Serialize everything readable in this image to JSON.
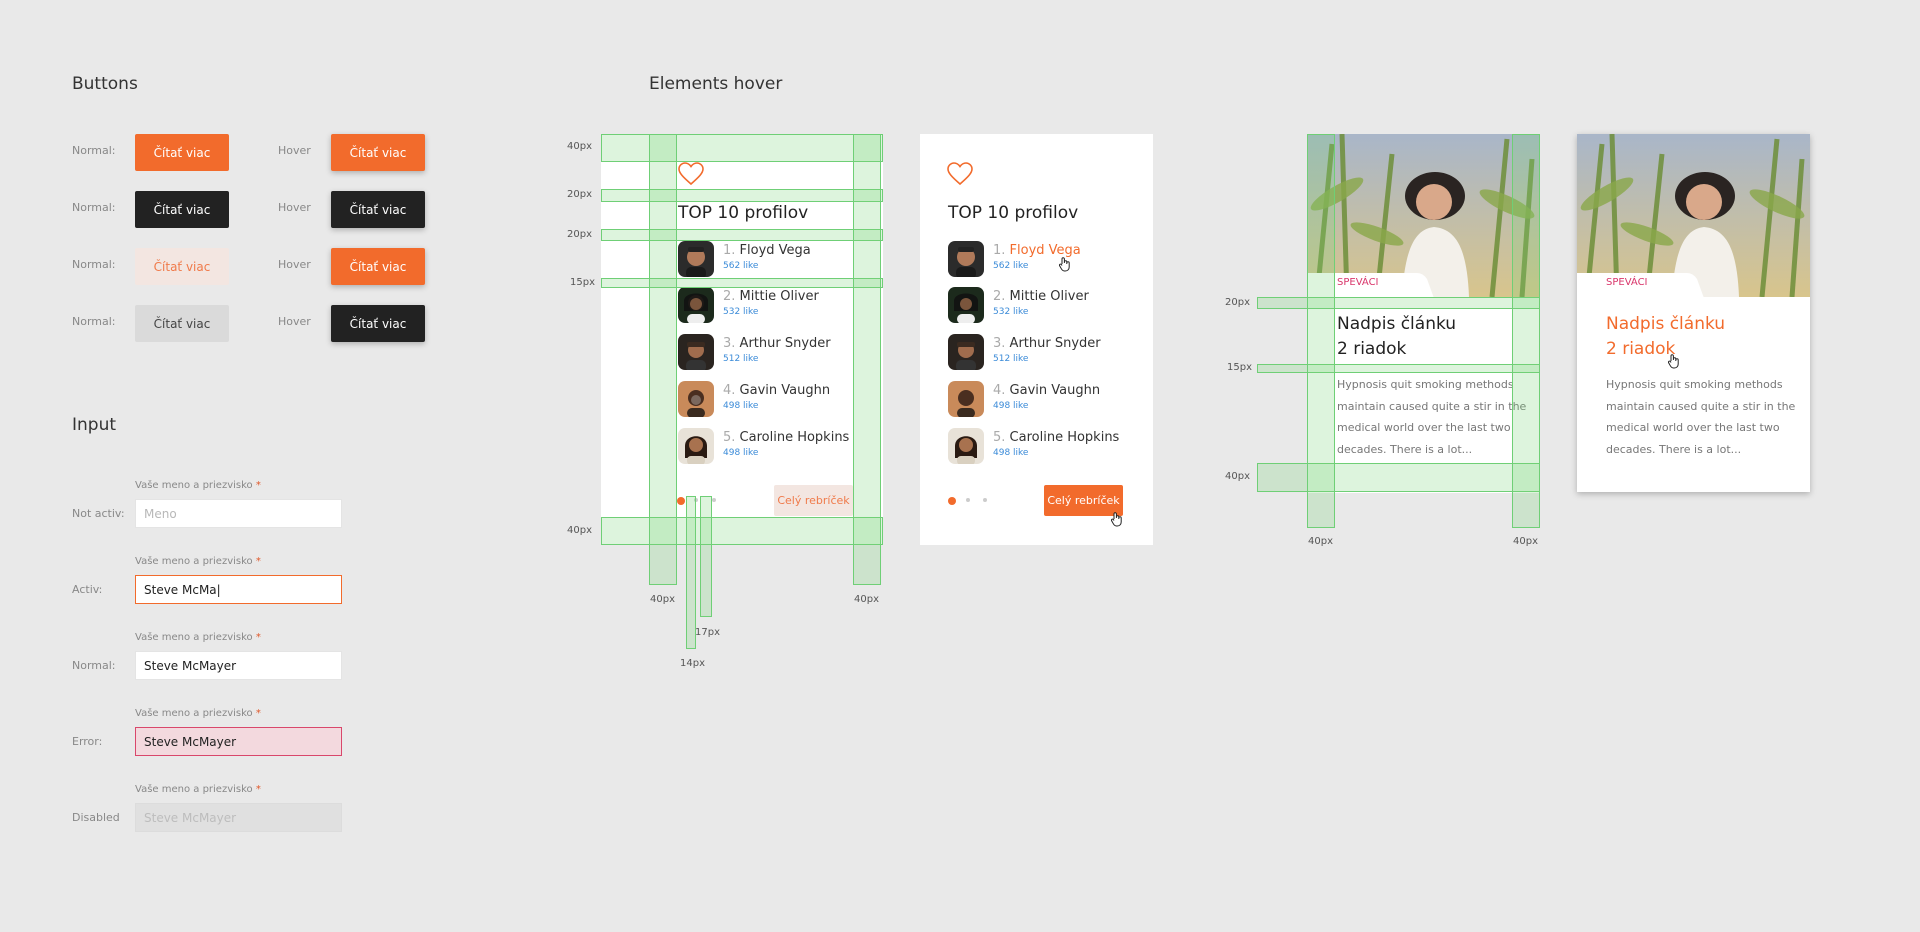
{
  "buttons_section": {
    "title": "Buttons",
    "normal_label": "Normal:",
    "hover_label": "Hover",
    "button_label": "Čítať viac"
  },
  "input_section": {
    "title": "Input",
    "field_label": "Vaše meno a priezvisko",
    "required_mark": "*",
    "rows": [
      {
        "state": "Not activ:",
        "value": "Meno"
      },
      {
        "state": "Activ:",
        "value": "Steve McMa|"
      },
      {
        "state": "Normal:",
        "value": "Steve McMayer"
      },
      {
        "state": "Error:",
        "value": "Steve McMayer"
      },
      {
        "state": "Disabled",
        "value": "Steve McMayer"
      }
    ]
  },
  "hover_section": {
    "title": "Elements hover"
  },
  "dimensions": {
    "d40": "40px",
    "d20": "20px",
    "d15": "15px",
    "d17": "17px",
    "d14": "14px"
  },
  "profiles_card": {
    "title": "TOP 10 profilov",
    "button_label": "Celý rebríček",
    "people": [
      {
        "num": "1.",
        "name": "Floyd Vega",
        "likes": "562 like"
      },
      {
        "num": "2.",
        "name": "Mittie Oliver",
        "likes": "532 like"
      },
      {
        "num": "3.",
        "name": "Arthur Snyder",
        "likes": "512 like"
      },
      {
        "num": "4.",
        "name": "Gavin Vaughn",
        "likes": "498 like"
      },
      {
        "num": "5.",
        "name": "Caroline Hopkins",
        "likes": "498 like"
      }
    ]
  },
  "article_card": {
    "tag": "SPEVÁCI",
    "title_line1": "Nadpis článku",
    "title_line2": "2 riadok",
    "text": "Hypnosis quit smoking methods maintain caused quite a stir in the medical world over the last two decades. There is a lot..."
  },
  "colors": {
    "accent": "#f26b2c",
    "dark": "#222222",
    "guide": "#6fcf76",
    "link_blue": "#3b8bd8",
    "tag_pink": "#d9366b",
    "error_border": "#d9476b"
  }
}
